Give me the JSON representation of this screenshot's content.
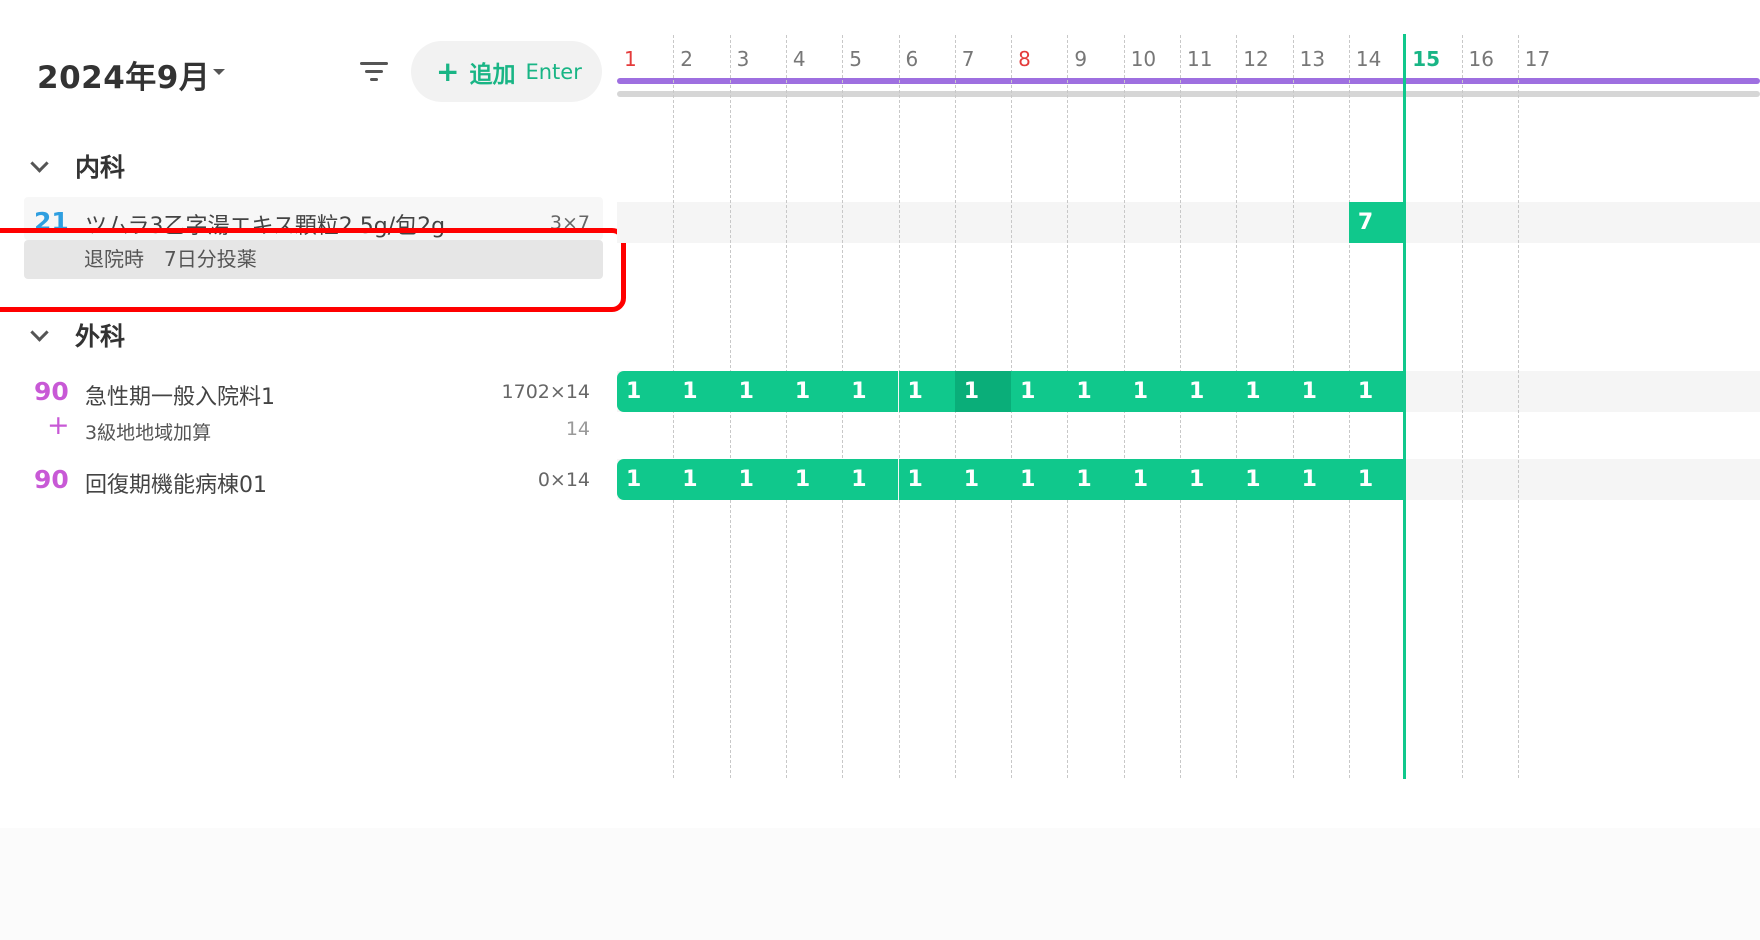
{
  "header": {
    "month": "2024年9月",
    "add_label": "追加",
    "add_shortcut": "Enter"
  },
  "days": [
    "1",
    "2",
    "3",
    "4",
    "5",
    "6",
    "7",
    "8",
    "9",
    "10",
    "11",
    "12",
    "13",
    "14",
    "15",
    "16",
    "17"
  ],
  "red_days": [
    "1",
    "8"
  ],
  "today": "15",
  "groups": [
    {
      "label": "内科",
      "rows": [
        {
          "code": "21",
          "code_color": "#2f9fe0",
          "name": "ツムラ3乙字湯エキス顆粒2.5g/包2g",
          "qty": "3×7",
          "note": "退院時　7日分投薬",
          "cells": [
            {
              "day": 14,
              "value": "7"
            }
          ]
        }
      ]
    },
    {
      "label": "外科",
      "rows": [
        {
          "code": "90",
          "code_color": "#c859d6",
          "name": "急性期一般入院料1",
          "qty": "1702×14",
          "sub_name": "3級地地域加算",
          "sub_qty": "14",
          "cells_value": "1",
          "cells_from": 1,
          "cells_to": 14,
          "dark_day": 7
        },
        {
          "code": "90",
          "code_color": "#c859d6",
          "name": "回復期機能病棟01",
          "qty": "0×14",
          "cells_value": "1",
          "cells_from": 1,
          "cells_to": 14
        }
      ]
    }
  ],
  "colors": {
    "accent": "#19b585",
    "bar": "#10c88c",
    "purple": "#9e6fe0",
    "highlight": "#ff0000"
  }
}
